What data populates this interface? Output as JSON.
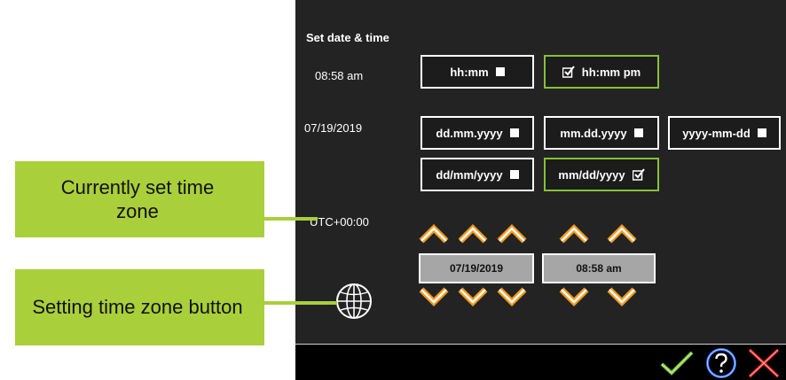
{
  "title": "Set date & time",
  "current_time": "08:58 am",
  "current_date": "07/19/2019",
  "timezone": "UTC+00:00",
  "time_formats": [
    {
      "label": "hh:mm",
      "selected": false
    },
    {
      "label": "hh:mm pm",
      "selected": true
    }
  ],
  "date_formats": [
    {
      "label": "dd.mm.yyyy",
      "selected": false
    },
    {
      "label": "mm.dd.yyyy",
      "selected": false
    },
    {
      "label": "yyyy-mm-dd",
      "selected": false
    },
    {
      "label": "dd/mm/yyyy",
      "selected": false
    },
    {
      "label": "mm/dd/yyyy",
      "selected": true
    }
  ],
  "date_display": "07/19/2019",
  "time_display": "08:58 am",
  "callouts": {
    "timezone": "Currently set time zone",
    "button": "Setting time zone button"
  },
  "icons": {
    "confirm": "checkmark-icon",
    "help": "question-icon",
    "cancel": "close-icon",
    "globe": "globe-icon"
  },
  "colors": {
    "background": "#232323",
    "selected_border": "#86c232",
    "arrow": "#f39a1e",
    "callout": "#a9cf3a",
    "cancel": "#e02020",
    "help": "#2f6fff"
  }
}
